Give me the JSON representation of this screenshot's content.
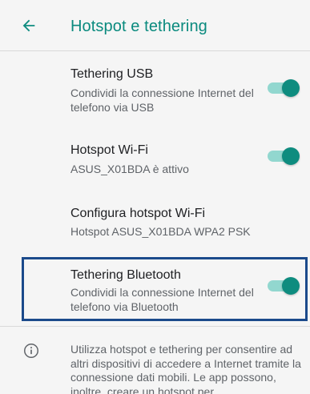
{
  "header": {
    "title": "Hotspot e tethering"
  },
  "items": [
    {
      "title": "Tethering USB",
      "subtitle": "Condividi la connessione Internet del telefono via USB",
      "toggle_on": true
    },
    {
      "title": "Hotspot Wi-Fi",
      "subtitle": "ASUS_X01BDA è attivo",
      "toggle_on": true
    },
    {
      "title": "Configura hotspot Wi-Fi",
      "subtitle": "Hotspot ASUS_X01BDA WPA2 PSK"
    },
    {
      "title": "Tethering Bluetooth",
      "subtitle": "Condividi la connessione Internet del telefono via Bluetooth",
      "toggle_on": true
    }
  ],
  "footer": {
    "text": "Utilizza hotspot e tethering per consentire ad altri dispositivi di accedere a Internet tramite la connessione dati mobili. Le app possono, inoltre, creare un hotspot per"
  },
  "colors": {
    "accent": "#0e8c7f",
    "track": "#92d7cf",
    "highlight": "#1b4a8b"
  },
  "icons": {
    "back": "arrow-back-icon",
    "info": "info-icon"
  }
}
